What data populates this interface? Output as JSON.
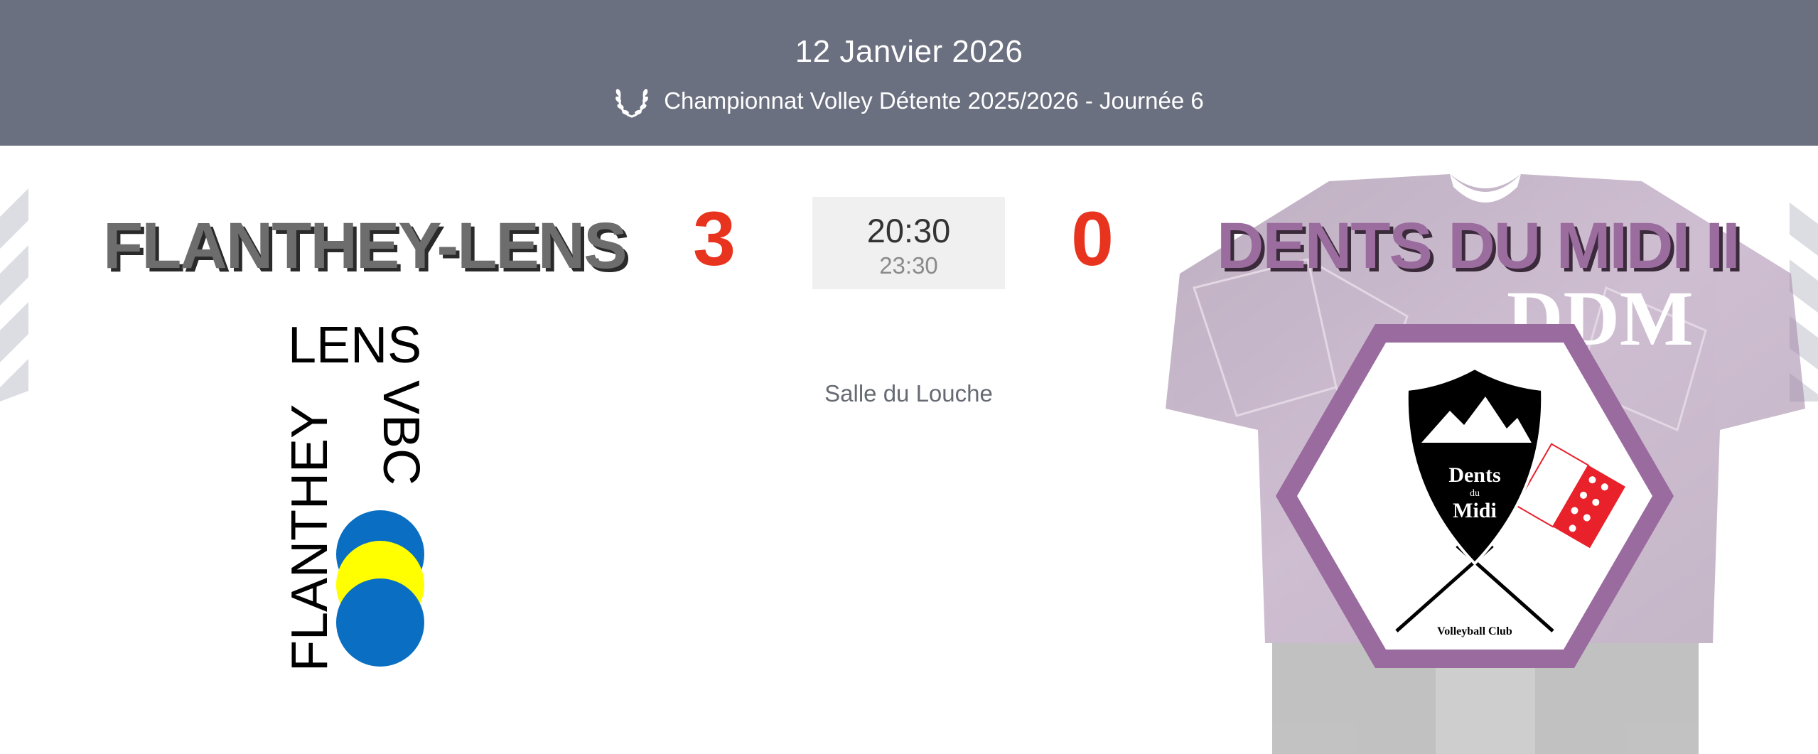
{
  "header": {
    "date": "12 Janvier 2026",
    "competition": "Championnat Volley Détente 2025/2026 - Journée 6",
    "competition_icon": "laurel-icon"
  },
  "match": {
    "home_team": "FLANTHEY-LENS",
    "away_team": "DENTS DU MIDI II",
    "home_score": "3",
    "away_score": "0",
    "start_time": "20:30",
    "end_time": "23:30",
    "venue": "Salle du Louche"
  },
  "home_logo": {
    "text_top": "LENS",
    "text_side": "FLANTHEY",
    "text_vbc": "VBC",
    "colors": [
      "#0a6fc2",
      "#ffff00"
    ]
  },
  "away_logo": {
    "text_name_1": "Dents",
    "text_du": "du",
    "text_name_2": "Midi",
    "text_club": "Volleyball Club",
    "jersey_text": "DDM",
    "border_color": "#9a6b9e"
  },
  "colors": {
    "header_bg": "#6b7080",
    "score": "#e8341f",
    "home_name": "#6d6d6d",
    "away_name": "#9b6d9f"
  }
}
